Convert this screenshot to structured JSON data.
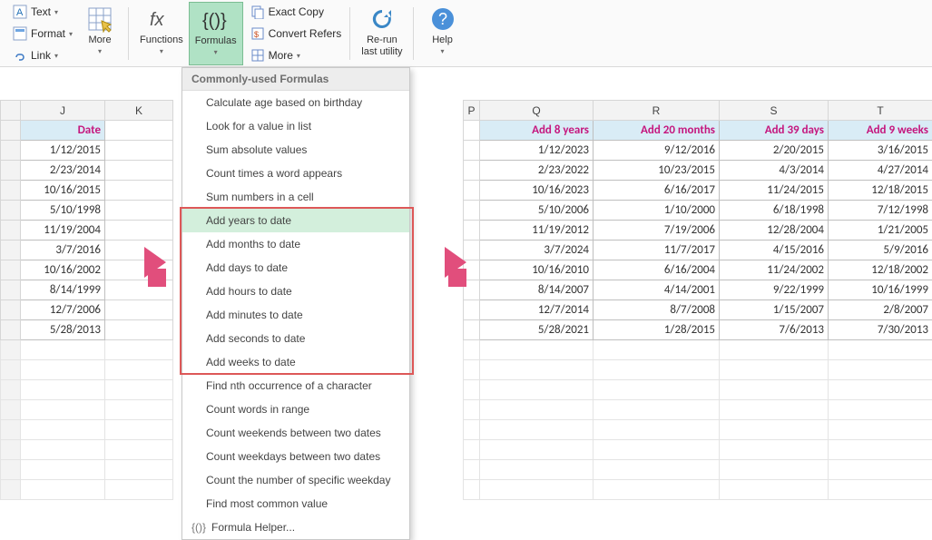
{
  "ribbon": {
    "text_label": "Text",
    "format_label": "Format",
    "link_label": "Link",
    "more1_label": "More",
    "functions_label": "Functions",
    "formulas_label": "Formulas",
    "exact_copy_label": "Exact Copy",
    "convert_refers_label": "Convert Refers",
    "more2_label": "More",
    "rerun_label": "Re-run\nlast utility",
    "help_label": "Help"
  },
  "dropdown": {
    "header": "Commonly-used Formulas",
    "items": [
      "Calculate age based on birthday",
      "Look for a value in list",
      "Sum absolute values",
      "Count times a word appears",
      "Sum numbers in a cell",
      "Add years to date",
      "Add months to date",
      "Add days to date",
      "Add hours to date",
      "Add minutes to date",
      "Add seconds to date",
      "Add weeks to date",
      "Find nth occurrence of a character",
      "Count words in range",
      "Count weekends between two dates",
      "Count weekdays between two dates",
      "Count the number of specific weekday",
      "Find most common value"
    ],
    "formula_helper": "Formula Helper..."
  },
  "columns": {
    "J": "J",
    "K": "K",
    "P": "P",
    "Q": "Q",
    "R": "R",
    "S": "S",
    "T": "T"
  },
  "headers": {
    "date": "Date",
    "q": "Add 8 years",
    "r": "Add 20 months",
    "s": "Add 39 days",
    "t": "Add 9 weeks"
  },
  "rows": [
    {
      "j": "1/12/2015",
      "q": "1/12/2023",
      "r": "9/12/2016",
      "s": "2/20/2015",
      "t": "3/16/2015"
    },
    {
      "j": "2/23/2014",
      "q": "2/23/2022",
      "r": "10/23/2015",
      "s": "4/3/2014",
      "t": "4/27/2014"
    },
    {
      "j": "10/16/2015",
      "q": "10/16/2023",
      "r": "6/16/2017",
      "s": "11/24/2015",
      "t": "12/18/2015"
    },
    {
      "j": "5/10/1998",
      "q": "5/10/2006",
      "r": "1/10/2000",
      "s": "6/18/1998",
      "t": "7/12/1998"
    },
    {
      "j": "11/19/2004",
      "q": "11/19/2012",
      "r": "7/19/2006",
      "s": "12/28/2004",
      "t": "1/21/2005"
    },
    {
      "j": "3/7/2016",
      "q": "3/7/2024",
      "r": "11/7/2017",
      "s": "4/15/2016",
      "t": "5/9/2016"
    },
    {
      "j": "10/16/2002",
      "q": "10/16/2010",
      "r": "6/16/2004",
      "s": "11/24/2002",
      "t": "12/18/2002"
    },
    {
      "j": "8/14/1999",
      "q": "8/14/2007",
      "r": "4/14/2001",
      "s": "9/22/1999",
      "t": "10/16/1999"
    },
    {
      "j": "12/7/2006",
      "q": "12/7/2014",
      "r": "8/7/2008",
      "s": "1/15/2007",
      "t": "2/8/2007"
    },
    {
      "j": "5/28/2013",
      "q": "5/28/2021",
      "r": "1/28/2015",
      "s": "7/6/2013",
      "t": "7/30/2013"
    }
  ]
}
